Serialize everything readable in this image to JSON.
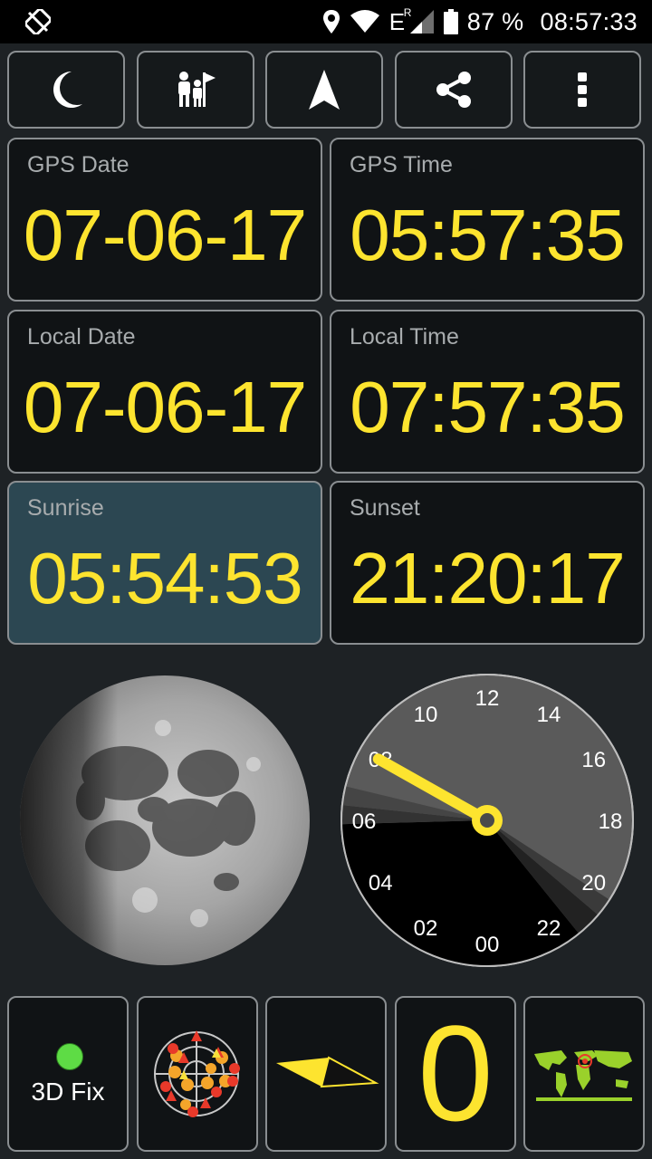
{
  "status_bar": {
    "battery": "87 %",
    "time": "08:57:33",
    "network": "E",
    "roaming": "R"
  },
  "toolbar": {
    "buttons": [
      {
        "icon": "moon-icon"
      },
      {
        "icon": "people-flag-icon"
      },
      {
        "icon": "navigation-arrow-icon"
      },
      {
        "icon": "share-icon"
      },
      {
        "icon": "more-vertical-icon"
      }
    ]
  },
  "tiles": {
    "gps_date": {
      "label": "GPS Date",
      "value": "07-06-17"
    },
    "gps_time": {
      "label": "GPS Time",
      "value": "05:57:35"
    },
    "local_date": {
      "label": "Local Date",
      "value": "07-06-17"
    },
    "local_time": {
      "label": "Local Time",
      "value": "07:57:35"
    },
    "sunrise": {
      "label": "Sunrise",
      "value": "05:54:53"
    },
    "sunset": {
      "label": "Sunset",
      "value": "21:20:17"
    }
  },
  "clock24": {
    "labels": [
      "00",
      "02",
      "04",
      "06",
      "08",
      "10",
      "12",
      "14",
      "16",
      "18",
      "20",
      "22"
    ],
    "hand_hour": 7.96
  },
  "bottom": {
    "fix_label": "3D Fix",
    "satellites_in_use": "0"
  },
  "colors": {
    "accent": "#fde42f",
    "fix_ok": "#5edc45",
    "sunrise_highlight": "#2c4752"
  }
}
